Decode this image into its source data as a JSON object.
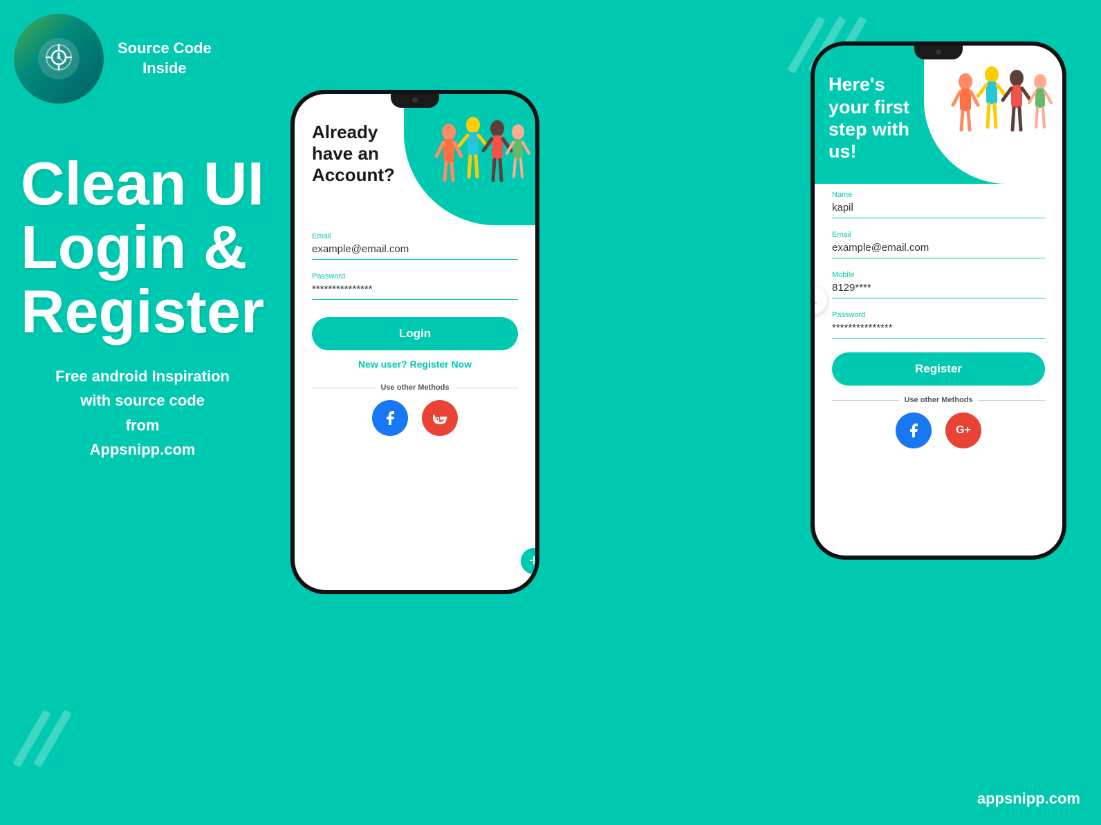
{
  "background": {
    "color": "#00C9B1"
  },
  "header": {
    "source_code_line1": "Source Code",
    "source_code_line2": "Inside"
  },
  "left": {
    "main_title_line1": "Clean UI",
    "main_title_line2": "Login &",
    "main_title_line3": "Register",
    "subtitle_line1": "Free android Inspiration",
    "subtitle_line2": "with source code",
    "subtitle_line3": "from",
    "subtitle_line4": "Appsnipp.com"
  },
  "domain": "appsnipp.com",
  "phone_login": {
    "header_line1": "Already",
    "header_line2": "have an",
    "header_line3": "Account?",
    "email_label": "Email",
    "email_value": "example@email.com",
    "password_label": "Password",
    "password_value": "***************",
    "login_button": "Login",
    "new_user_link": "New user? Register Now",
    "use_other_methods": "Use other Methods"
  },
  "phone_register": {
    "header_line1": "Here's",
    "header_line2": "your first",
    "header_line3": "step with",
    "header_line4": "us!",
    "name_label": "Name",
    "name_value": "kapil",
    "email_label": "Email",
    "email_value": "example@email.com",
    "mobile_label": "Mobile",
    "mobile_value": "8129****",
    "password_label": "Password",
    "password_value": "***************",
    "register_button": "Register",
    "use_other_methods": "Use other Methods"
  }
}
